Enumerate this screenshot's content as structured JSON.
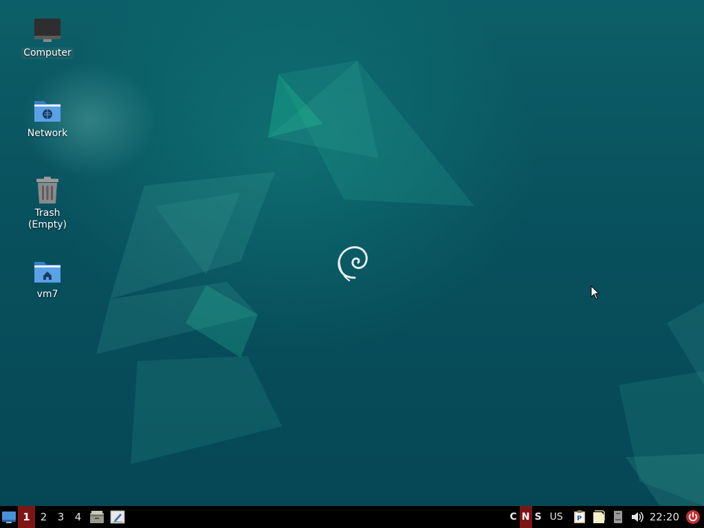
{
  "desktop": {
    "icons": [
      {
        "label": "Computer",
        "icon": "computer-icon"
      },
      {
        "label": "Network",
        "icon": "network-folder-icon"
      },
      {
        "label": "Trash\n(Empty)",
        "icon": "trash-icon"
      },
      {
        "label": "vm7",
        "icon": "home-folder-icon"
      }
    ],
    "wallpaper_logo": "debian-swirl-icon"
  },
  "taskbar": {
    "workspaces": [
      "1",
      "2",
      "3",
      "4"
    ],
    "active_workspace": "1",
    "launchers": [
      "file-manager-icon",
      "text-editor-icon"
    ],
    "lock_indicators": [
      {
        "label": "C",
        "on": false
      },
      {
        "label": "N",
        "on": true
      },
      {
        "label": "S",
        "on": false
      }
    ],
    "keyboard_layout": "US",
    "tray_icons": [
      "clipboard-icon",
      "notes-icon",
      "storage-icon",
      "volume-icon"
    ],
    "clock": "22:20",
    "colors": {
      "active_workspace": "#7d1515",
      "panel": "#000000"
    }
  }
}
